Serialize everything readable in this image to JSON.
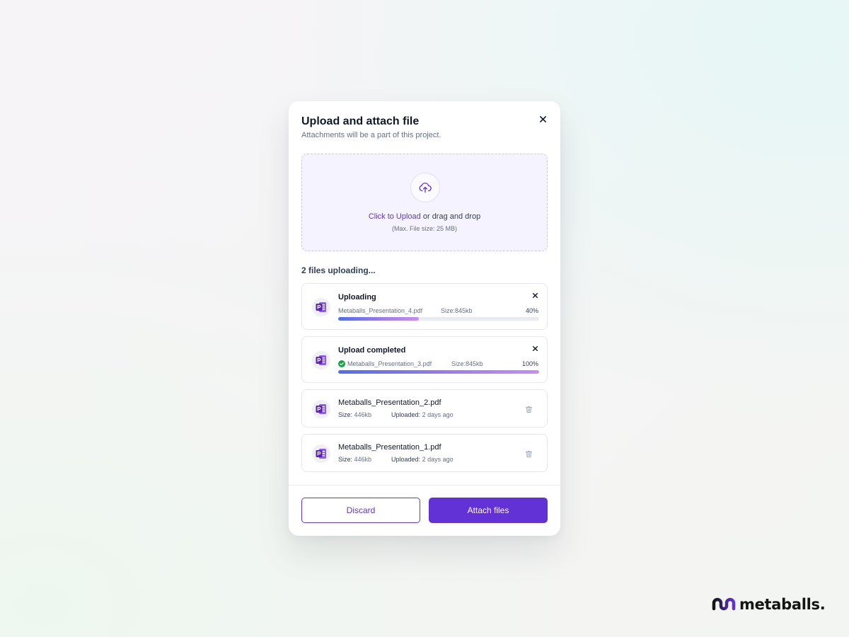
{
  "modal": {
    "title": "Upload and attach file",
    "subtitle": "Attachments will be a part of this project.",
    "close_icon": "close-icon"
  },
  "dropzone": {
    "icon": "cloud-upload-icon",
    "link_text": "Click to Upload",
    "rest_text": " or drag and drop",
    "hint": "(Max. File size: 25 MB)"
  },
  "files_heading": "2 files uploading...",
  "uploads": [
    {
      "status": "Uploading",
      "filename": "Metaballs_Presentation_4.pdf",
      "size_label": "Size:",
      "size_value": "845kb",
      "percent_label": "40%",
      "progress": 0.4
    },
    {
      "status": "Upload completed",
      "filename": "Metaballs_Presentation_3.pdf",
      "size_label": "Size:",
      "size_value": "845kb",
      "percent_label": "100%",
      "progress": 1.0
    }
  ],
  "uploaded": [
    {
      "filename": "Metaballs_Presentation_2.pdf",
      "size_label": "Size:",
      "size_value": "446kb",
      "uploaded_label": "Uploaded:",
      "uploaded_value": "2 days ago"
    },
    {
      "filename": "Metaballs_Presentation_1.pdf",
      "size_label": "Size:",
      "size_value": "446kb",
      "uploaded_label": "Uploaded:",
      "uploaded_value": "2 days ago"
    }
  ],
  "footer": {
    "discard_label": "Discard",
    "attach_label": "Attach files"
  },
  "brand": {
    "name": "metaballs."
  },
  "colors": {
    "accent": "#6232d6",
    "success": "#16a34a",
    "progress_start": "#4d6df3",
    "progress_end": "#c98cf5"
  }
}
